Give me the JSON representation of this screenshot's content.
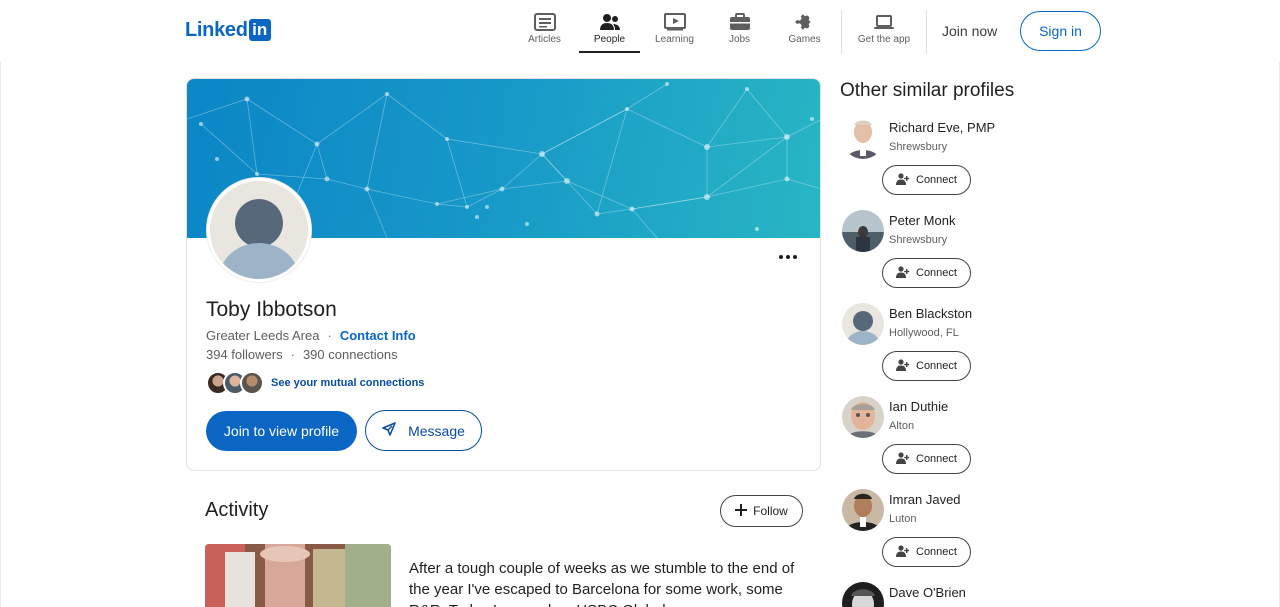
{
  "header": {
    "logo_text": "Linked",
    "logo_in": "in",
    "nav": [
      {
        "label": "Articles",
        "icon": "articles-icon"
      },
      {
        "label": "People",
        "icon": "people-icon",
        "active": true
      },
      {
        "label": "Learning",
        "icon": "learning-icon"
      },
      {
        "label": "Jobs",
        "icon": "briefcase-icon"
      },
      {
        "label": "Games",
        "icon": "puzzle-icon"
      },
      {
        "label": "Get the app",
        "icon": "laptop-icon"
      }
    ],
    "join_now": "Join now",
    "sign_in": "Sign in"
  },
  "profile": {
    "name": "Toby Ibbotson",
    "location": "Greater Leeds Area",
    "contact_info": "Contact Info",
    "followers": "394 followers",
    "connections": "390 connections",
    "mutual_link": "See your mutual connections",
    "join_button": "Join to view profile",
    "message_button": "Message"
  },
  "activity": {
    "title": "Activity",
    "follow": "Follow",
    "post_text": "After a tough couple of weeks as we stumble to the end of the year I've escaped to Barcelona for some work, some R&R. Today I opened an HSBC Global"
  },
  "sidebar": {
    "title": "Other similar profiles",
    "connect_label": "Connect",
    "profiles": [
      {
        "name": "Richard Eve, PMP",
        "location": "Shrewsbury"
      },
      {
        "name": "Peter Monk",
        "location": "Shrewsbury"
      },
      {
        "name": "Ben Blackston",
        "location": "Hollywood, FL"
      },
      {
        "name": "Ian Duthie",
        "location": "Alton"
      },
      {
        "name": "Imran Javed",
        "location": "Luton"
      },
      {
        "name": "Dave O'Brien",
        "location": ""
      }
    ]
  },
  "colors": {
    "brand": "#0a66c2",
    "link": "#0a4ca0"
  }
}
